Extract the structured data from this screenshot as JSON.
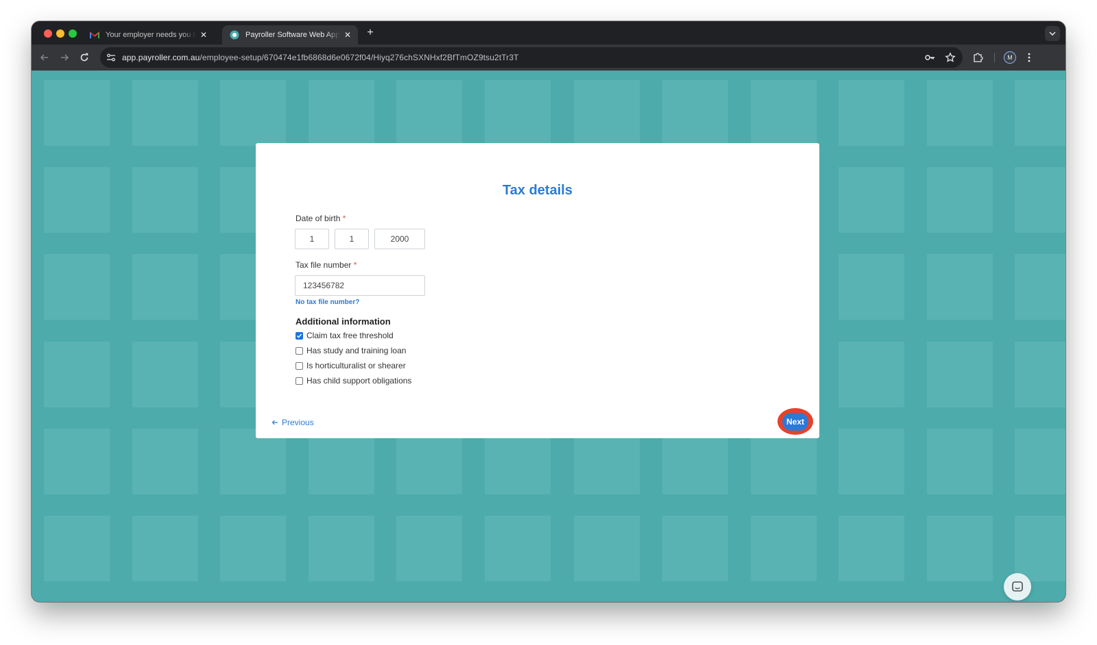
{
  "browser": {
    "tabs": [
      {
        "title": "Your employer needs you to fi",
        "favicon": "gmail-icon",
        "active": false
      },
      {
        "title": "Payroller Software Web Applic",
        "favicon": "payroller-icon",
        "active": true
      }
    ],
    "new_tab_label": "+",
    "url_host": "app.payroller.com.au",
    "url_path": "/employee-setup/670474e1fb6868d6e0672f04/Hiyq276chSXNHxf2BfTmOZ9tsu2tTr3T",
    "profile_initial": "M"
  },
  "form": {
    "title": "Tax details",
    "dob_label": "Date of birth",
    "required_mark": "*",
    "dob_day": "1",
    "dob_month": "1",
    "dob_year": "2000",
    "tfn_label": "Tax file number",
    "tfn_value": "123456782",
    "no_tfn_link": "No tax file number?",
    "additional_heading": "Additional information",
    "options": [
      {
        "label": "Claim tax free threshold",
        "checked": true
      },
      {
        "label": "Has study and training loan",
        "checked": false
      },
      {
        "label": "Is horticulturalist or shearer",
        "checked": false
      },
      {
        "label": "Has child support obligations",
        "checked": false
      }
    ],
    "previous_label": "Previous",
    "next_label": "Next"
  },
  "colors": {
    "accent": "#2a7ad6",
    "background": "#4dabab",
    "highlight_ring": "#e8412c"
  }
}
